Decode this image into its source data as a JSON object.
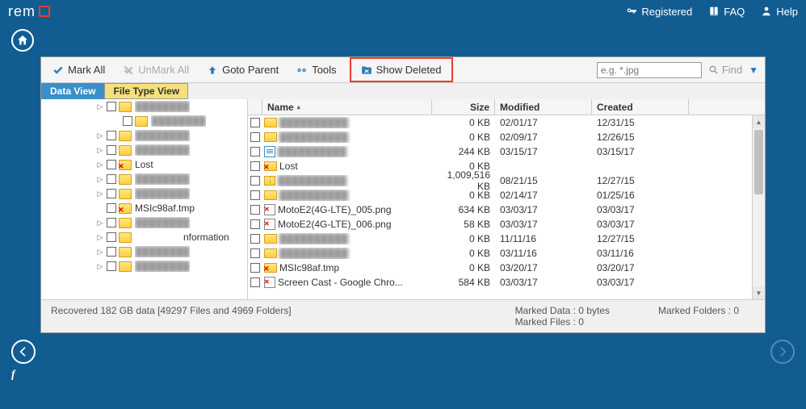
{
  "brand": {
    "text": "rem"
  },
  "header": {
    "registered": "Registered",
    "faq": "FAQ",
    "help": "Help"
  },
  "toolbar": {
    "mark_all": "Mark All",
    "unmark_all": "UnMark All",
    "goto_parent": "Goto Parent",
    "tools": "Tools",
    "show_deleted": "Show Deleted",
    "search_placeholder": "e.g. *.jpg",
    "find": "Find"
  },
  "tabs": {
    "data_view": "Data View",
    "file_type_view": "File Type View"
  },
  "tree": {
    "items": [
      {
        "depth": 1,
        "expandable": true,
        "deleted": false,
        "label": "",
        "blur": true
      },
      {
        "depth": 2,
        "expandable": false,
        "deleted": false,
        "label": "",
        "blur": true
      },
      {
        "depth": 1,
        "expandable": true,
        "deleted": false,
        "label": "",
        "blur": true
      },
      {
        "depth": 1,
        "expandable": true,
        "deleted": false,
        "label": "",
        "blur": true
      },
      {
        "depth": 1,
        "expandable": true,
        "deleted": true,
        "label": "Lost",
        "blur": false
      },
      {
        "depth": 1,
        "expandable": true,
        "deleted": false,
        "label": "",
        "blur": true
      },
      {
        "depth": 1,
        "expandable": true,
        "deleted": false,
        "label": "",
        "blur": true
      },
      {
        "depth": 1,
        "expandable": false,
        "deleted": true,
        "label": "MSIc98af.tmp",
        "blur": false
      },
      {
        "depth": 1,
        "expandable": true,
        "deleted": false,
        "label": "",
        "blur": true
      },
      {
        "depth": 1,
        "expandable": true,
        "deleted": false,
        "label": "nformation",
        "blur": false,
        "indent_label": true
      },
      {
        "depth": 1,
        "expandable": true,
        "deleted": false,
        "label": "",
        "blur": true
      },
      {
        "depth": 1,
        "expandable": true,
        "deleted": false,
        "label": "",
        "blur": true
      }
    ]
  },
  "list": {
    "columns": {
      "name": "Name",
      "size": "Size",
      "modified": "Modified",
      "created": "Created"
    },
    "rows": [
      {
        "icon": "folder",
        "name": "",
        "blur": true,
        "size": "0 KB",
        "modified": "02/01/17",
        "created": "12/31/15"
      },
      {
        "icon": "folder",
        "name": "",
        "blur": true,
        "size": "0 KB",
        "modified": "02/09/17",
        "created": "12/26/15"
      },
      {
        "icon": "doc",
        "name": "",
        "blur": true,
        "size": "244 KB",
        "modified": "03/15/17",
        "created": "03/15/17"
      },
      {
        "icon": "folderx",
        "name": "Lost",
        "blur": false,
        "size": "0 KB",
        "modified": "",
        "created": ""
      },
      {
        "icon": "zip",
        "name": "",
        "blur": true,
        "size": "1,009,516 KB",
        "modified": "08/21/15",
        "created": "12/27/15"
      },
      {
        "icon": "folder",
        "name": "",
        "blur": true,
        "size": "0 KB",
        "modified": "02/14/17",
        "created": "01/25/16"
      },
      {
        "icon": "img",
        "name": "MotoE2(4G-LTE)_005.png",
        "blur": false,
        "size": "634 KB",
        "modified": "03/03/17",
        "created": "03/03/17"
      },
      {
        "icon": "img",
        "name": "MotoE2(4G-LTE)_006.png",
        "blur": false,
        "size": "58 KB",
        "modified": "03/03/17",
        "created": "03/03/17"
      },
      {
        "icon": "folder",
        "name": "",
        "blur": true,
        "size": "0 KB",
        "modified": "11/11/16",
        "created": "12/27/15"
      },
      {
        "icon": "folder",
        "name": "",
        "blur": true,
        "size": "0 KB",
        "modified": "03/11/16",
        "created": "03/11/16"
      },
      {
        "icon": "folderx",
        "name": "MSIc98af.tmp",
        "blur": false,
        "size": "0 KB",
        "modified": "03/20/17",
        "created": "03/20/17"
      },
      {
        "icon": "img",
        "name": "Screen Cast - Google Chro...",
        "blur": false,
        "size": "584 KB",
        "modified": "03/03/17",
        "created": "03/03/17"
      }
    ]
  },
  "status": {
    "recovered": "Recovered 182 GB data [49297 Files and 4969 Folders]",
    "marked_data": "Marked Data : 0 bytes",
    "marked_files": "Marked Files : 0",
    "marked_folders": "Marked Folders : 0"
  }
}
